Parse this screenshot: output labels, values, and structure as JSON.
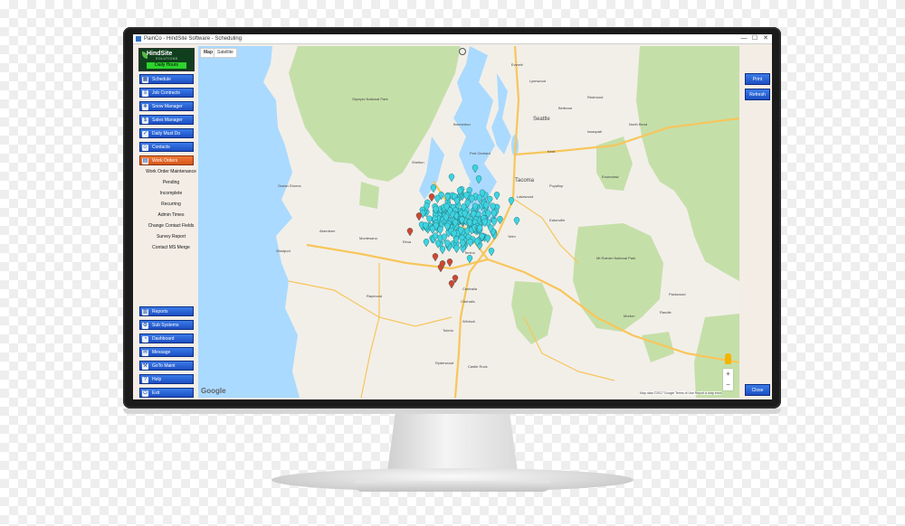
{
  "window": {
    "title": "PainCo - HindSite Software - Scheduling",
    "controls": [
      "—",
      "☐",
      "✕"
    ]
  },
  "logo": {
    "brand": "HindSite",
    "sub": "SOLUTIONS",
    "badge": "Daily Hours"
  },
  "sidebar": {
    "top_items": [
      {
        "label": "Schedule",
        "icon": "calendar-icon",
        "glyph": "▦"
      },
      {
        "label": "Job Contracts",
        "icon": "contract-icon",
        "glyph": "≡"
      },
      {
        "label": "Snow Manager",
        "icon": "snow-icon",
        "glyph": "❄"
      },
      {
        "label": "Sales Manager",
        "icon": "dollar-icon",
        "glyph": "$"
      },
      {
        "label": "Daily Must Do",
        "icon": "checklist-icon",
        "glyph": "✓"
      },
      {
        "label": "Contacts",
        "icon": "contacts-icon",
        "glyph": "☺"
      },
      {
        "label": "Work Orders",
        "icon": "work-orders-icon",
        "glyph": "▤",
        "active": true
      }
    ],
    "sub_items": [
      "Work Order Maintenance",
      "Pending",
      "Incomplete",
      "Recurring",
      "Admin Times",
      "Change Contact Fields",
      "Survey Report",
      "Contact MS Merge"
    ],
    "bottom_items": [
      {
        "label": "Reports",
        "icon": "reports-icon",
        "glyph": "▥"
      },
      {
        "label": "Sub Systems",
        "icon": "subsystems-icon",
        "glyph": "⚙"
      },
      {
        "label": "Dashboard",
        "icon": "dashboard-icon",
        "glyph": "◔"
      },
      {
        "label": "Message",
        "icon": "message-icon",
        "glyph": "✉"
      },
      {
        "label": "GoTo Maint",
        "icon": "maintenance-icon",
        "glyph": "⚒"
      },
      {
        "label": "Help",
        "icon": "help-icon",
        "glyph": "?"
      },
      {
        "label": "Exit",
        "icon": "exit-icon",
        "glyph": "⏻"
      }
    ]
  },
  "map": {
    "tabs": [
      "Map",
      "Satellite"
    ],
    "active_tab": "Map",
    "provider": "Google",
    "attribution": "Map data ©2017 Google   Terms of Use   Report a map error",
    "zoom_in": "+",
    "zoom_out": "−",
    "colors": {
      "water": "#aadaff",
      "land": "#f2efe9",
      "park": "#c5dfa9",
      "road": "#f7c65b",
      "pin_cyan": "#3dd3e0",
      "pin_red": "#d2452d"
    },
    "labels": [
      "Seattle",
      "Bellevue",
      "Redmond",
      "Kent",
      "Tacoma",
      "Lakewood",
      "Olympia",
      "Aberdeen",
      "Centralia",
      "Chehalis",
      "Shelton",
      "Bremerton",
      "Everett",
      "Lynnwood",
      "Puyallup",
      "Enumclaw",
      "Raymond",
      "Mt Rainier National Park",
      "Olympic National Park",
      "Morton",
      "Yelm",
      "Tenino",
      "Elma",
      "Montesano",
      "Ocean Shores",
      "Westport",
      "Winlock",
      "Toledo",
      "Castle Rock",
      "Ryderwood",
      "Packwood",
      "Randle",
      "Eatonville",
      "Issaquah",
      "North Bend",
      "Port Orchard"
    ]
  },
  "right_panel": {
    "print_label": "Print",
    "refresh_label": "Refresh",
    "close_label": "Close"
  }
}
